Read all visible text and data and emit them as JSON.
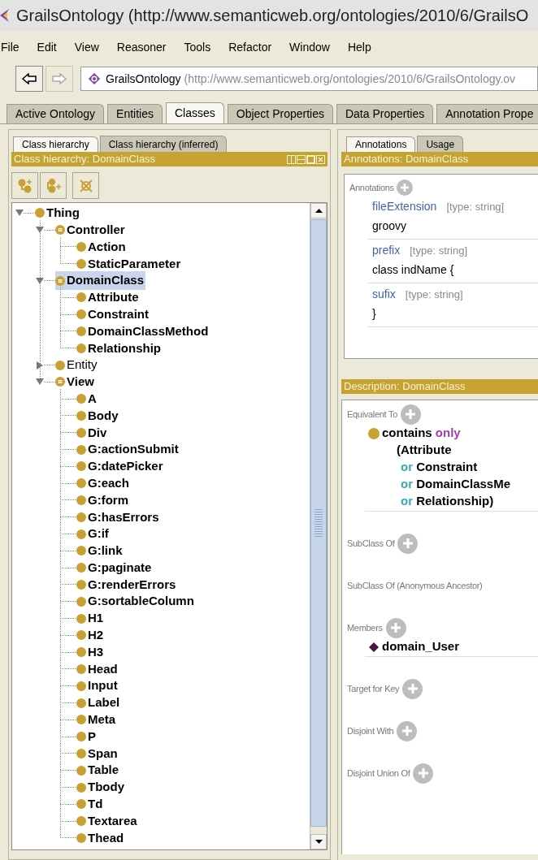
{
  "window": {
    "title": "GrailsOntology (http://www.semanticweb.org/ontologies/2010/6/GrailsO"
  },
  "menu": [
    "File",
    "Edit",
    "View",
    "Reasoner",
    "Tools",
    "Refactor",
    "Window",
    "Help"
  ],
  "nav": {
    "buttons": [
      {
        "kind": "back",
        "disabled": false
      },
      {
        "kind": "forward",
        "disabled": true
      }
    ],
    "ontology_name": "GrailsOntology",
    "ontology_iri": "(http://www.semanticweb.org/ontologies/2010/6/GrailsOntology.ov"
  },
  "tabs": [
    {
      "label": "Active Ontology",
      "selected": false
    },
    {
      "label": "Entities",
      "selected": false
    },
    {
      "label": "Classes",
      "selected": true
    },
    {
      "label": "Object Properties",
      "selected": false
    },
    {
      "label": "Data Properties",
      "selected": false
    },
    {
      "label": "Annotation Prope",
      "selected": false
    }
  ],
  "hierarchy_tabs": [
    {
      "label": "Class hierarchy",
      "selected": true
    },
    {
      "label": "Class hierarchy (inferred)",
      "selected": false
    }
  ],
  "hierarchy_panel": {
    "title": "Class hierarchy: DomainClass",
    "tree": [
      {
        "label": "Thing",
        "kind": "primitive",
        "bold": true,
        "selected": false,
        "expanded": true,
        "children": [
          {
            "label": "Controller",
            "kind": "defined",
            "bold": true,
            "selected": false,
            "expanded": true,
            "children": [
              {
                "label": "Action",
                "kind": "primitive",
                "bold": true,
                "selected": false
              },
              {
                "label": "StaticParameter",
                "kind": "primitive",
                "bold": true,
                "selected": false
              }
            ]
          },
          {
            "label": "DomainClass",
            "kind": "defined",
            "bold": true,
            "selected": true,
            "expanded": true,
            "children": [
              {
                "label": "Attribute",
                "kind": "primitive",
                "bold": true,
                "selected": false
              },
              {
                "label": "Constraint",
                "kind": "primitive",
                "bold": true,
                "selected": false
              },
              {
                "label": "DomainClassMethod",
                "kind": "primitive",
                "bold": true,
                "selected": false
              },
              {
                "label": "Relationship",
                "kind": "primitive",
                "bold": true,
                "selected": false
              }
            ]
          },
          {
            "label": "Entity",
            "kind": "primitive",
            "bold": false,
            "selected": false,
            "expanded": false
          },
          {
            "label": "View",
            "kind": "defined",
            "bold": true,
            "selected": false,
            "expanded": true,
            "children": [
              {
                "label": "A",
                "kind": "primitive",
                "bold": true,
                "selected": false
              },
              {
                "label": "Body",
                "kind": "primitive",
                "bold": true,
                "selected": false
              },
              {
                "label": "Div",
                "kind": "primitive",
                "bold": true,
                "selected": false
              },
              {
                "label": "G:actionSubmit",
                "kind": "primitive",
                "bold": true,
                "selected": false
              },
              {
                "label": "G:datePicker",
                "kind": "primitive",
                "bold": true,
                "selected": false
              },
              {
                "label": "G:each",
                "kind": "primitive",
                "bold": true,
                "selected": false
              },
              {
                "label": "G:form",
                "kind": "primitive",
                "bold": true,
                "selected": false
              },
              {
                "label": "G:hasErrors",
                "kind": "primitive",
                "bold": true,
                "selected": false
              },
              {
                "label": "G:if",
                "kind": "primitive",
                "bold": true,
                "selected": false
              },
              {
                "label": "G:link",
                "kind": "primitive",
                "bold": true,
                "selected": false
              },
              {
                "label": "G:paginate",
                "kind": "primitive",
                "bold": true,
                "selected": false
              },
              {
                "label": "G:renderErrors",
                "kind": "primitive",
                "bold": true,
                "selected": false
              },
              {
                "label": "G:sortableColumn",
                "kind": "primitive",
                "bold": true,
                "selected": false
              },
              {
                "label": "H1",
                "kind": "primitive",
                "bold": true,
                "selected": false
              },
              {
                "label": "H2",
                "kind": "primitive",
                "bold": true,
                "selected": false
              },
              {
                "label": "H3",
                "kind": "primitive",
                "bold": true,
                "selected": false
              },
              {
                "label": "Head",
                "kind": "primitive",
                "bold": true,
                "selected": false
              },
              {
                "label": "Input",
                "kind": "primitive",
                "bold": true,
                "selected": false
              },
              {
                "label": "Label",
                "kind": "primitive",
                "bold": true,
                "selected": false
              },
              {
                "label": "Meta",
                "kind": "primitive",
                "bold": true,
                "selected": false
              },
              {
                "label": "P",
                "kind": "primitive",
                "bold": true,
                "selected": false
              },
              {
                "label": "Span",
                "kind": "primitive",
                "bold": true,
                "selected": false
              },
              {
                "label": "Table",
                "kind": "primitive",
                "bold": true,
                "selected": false
              },
              {
                "label": "Tbody",
                "kind": "primitive",
                "bold": true,
                "selected": false
              },
              {
                "label": "Td",
                "kind": "primitive",
                "bold": true,
                "selected": false
              },
              {
                "label": "Textarea",
                "kind": "primitive",
                "bold": true,
                "selected": false
              },
              {
                "label": "Thead",
                "kind": "primitive",
                "bold": true,
                "selected": false
              }
            ]
          }
        ]
      }
    ]
  },
  "annotation_tabs": [
    {
      "label": "Annotations",
      "selected": true
    },
    {
      "label": "Usage",
      "selected": false
    }
  ],
  "annotations_panel": {
    "title": "Annotations: DomainClass",
    "section": "Annotations",
    "items": [
      {
        "property": "fileExtension",
        "type": "[type: string]",
        "value": "groovy"
      },
      {
        "property": "prefix",
        "type": "[type: string]",
        "value": "class indName {"
      },
      {
        "property": "sufix",
        "type": "[type: string]",
        "value": "}"
      }
    ]
  },
  "description_panel": {
    "title": "Description: DomainClass",
    "sections": [
      {
        "label": "Equivalent To",
        "entries": [
          {
            "kind": "class_expression",
            "lines": [
              [
                {
                  "text": "contains",
                  "kind": "name"
                },
                {
                  "text": "only",
                  "kind": "keyword"
                }
              ],
              [
                {
                  "text": "(Attribute",
                  "kind": "name"
                }
              ],
              [
                {
                  "text": "or",
                  "kind": "operator"
                },
                {
                  "text": "Constraint",
                  "kind": "name"
                }
              ],
              [
                {
                  "text": "or",
                  "kind": "operator"
                },
                {
                  "text": "DomainClassMe",
                  "kind": "name"
                }
              ],
              [
                {
                  "text": "or",
                  "kind": "operator"
                },
                {
                  "text": "Relationship)",
                  "kind": "name"
                }
              ]
            ]
          }
        ]
      },
      {
        "label": "SubClass Of"
      },
      {
        "label": "SubClass Of (Anonymous Ancestor)",
        "addable": false
      },
      {
        "label": "Members",
        "entries": [
          {
            "kind": "individual",
            "lines": [
              [
                {
                  "text": "domain_User",
                  "kind": "name"
                }
              ]
            ]
          }
        ]
      },
      {
        "label": "Target for Key"
      },
      {
        "label": "Disjoint With"
      },
      {
        "label": "Disjoint Union Of"
      }
    ]
  }
}
